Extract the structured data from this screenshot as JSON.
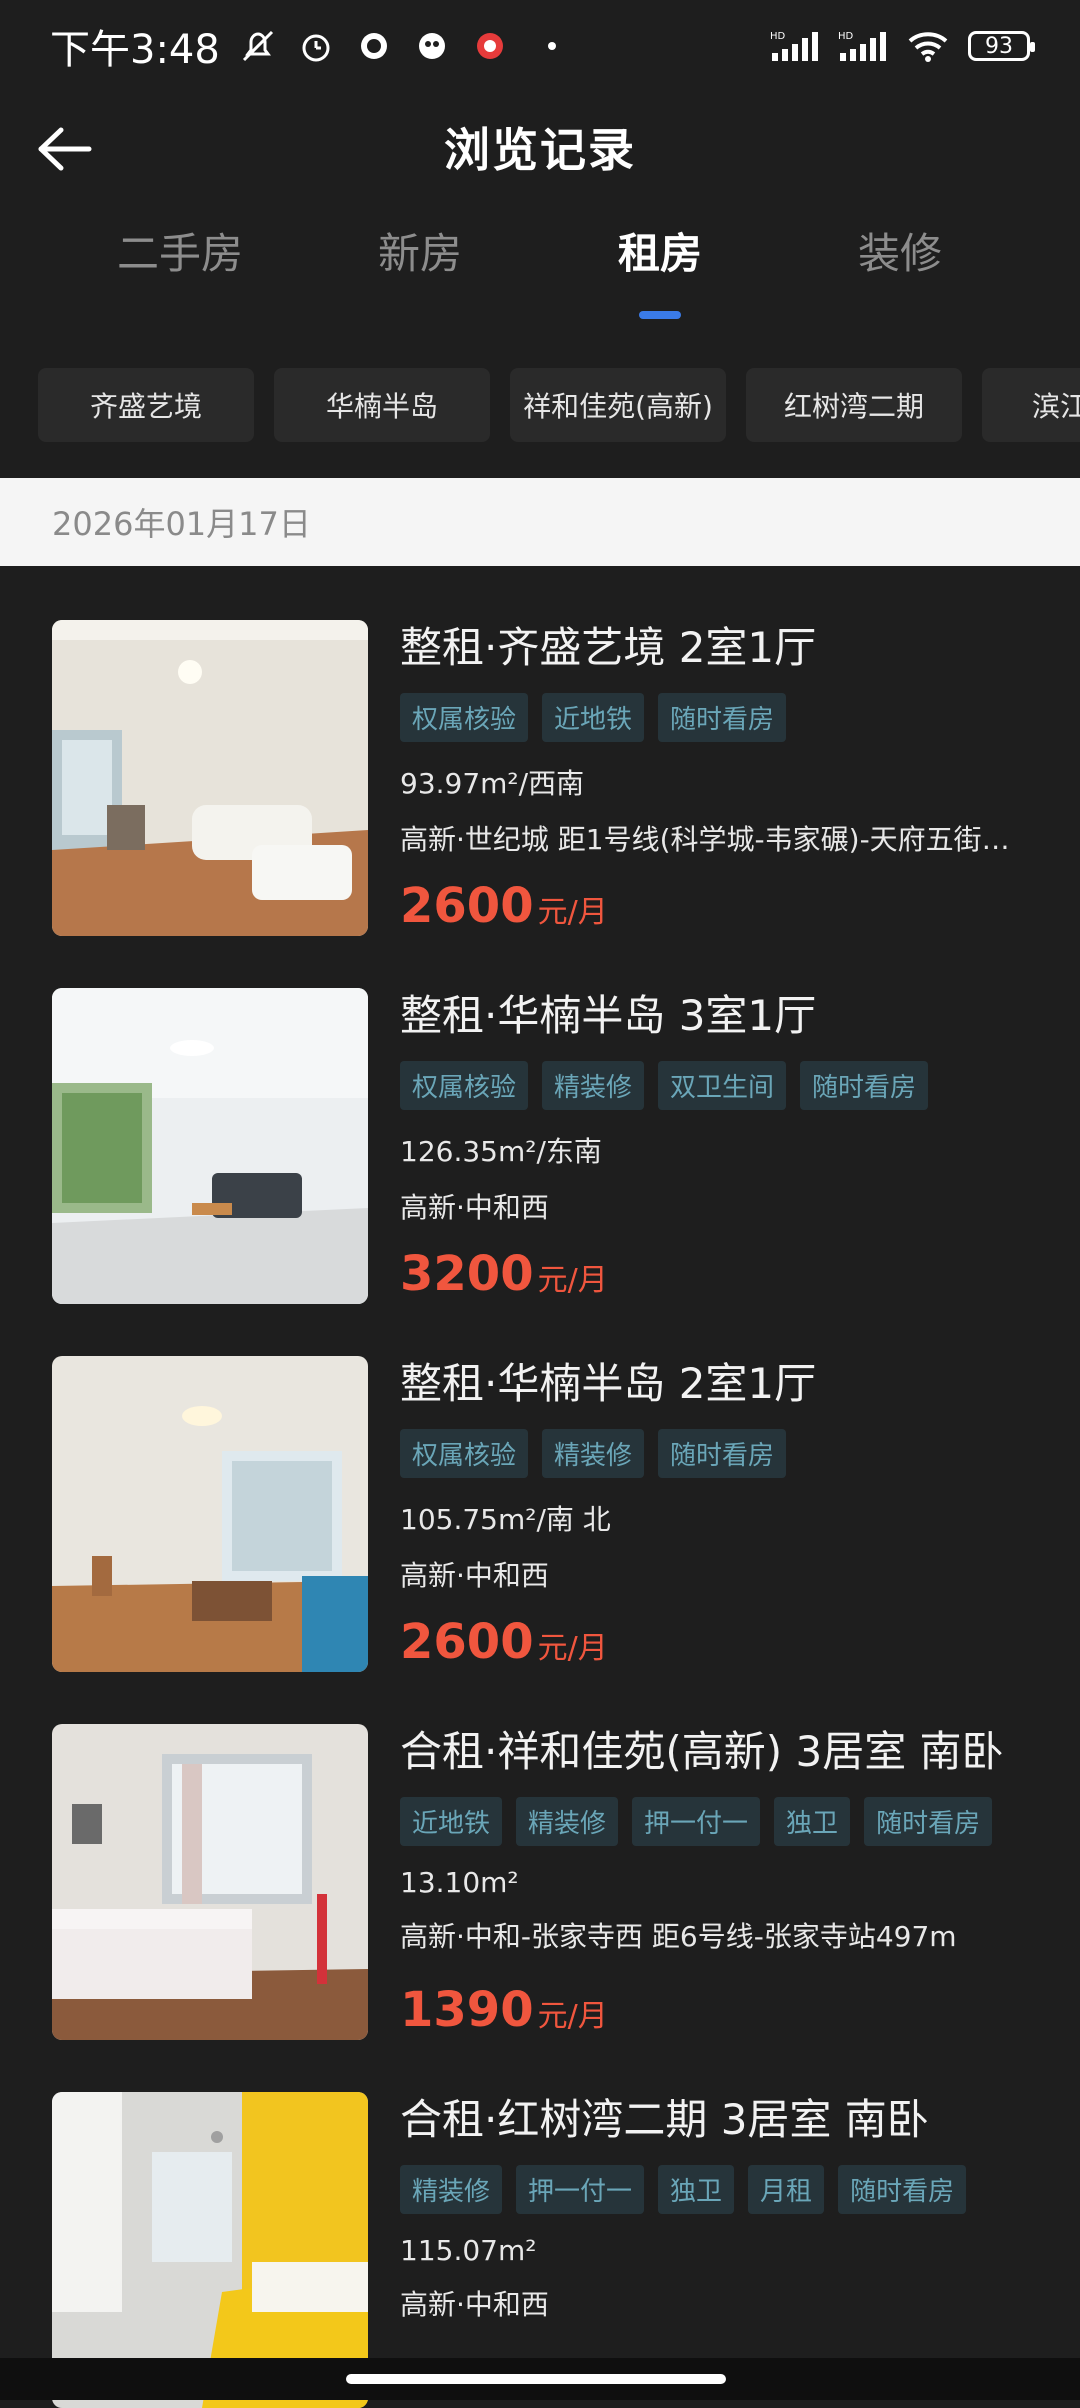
{
  "status_bar": {
    "time": "下午3:48",
    "battery": "93"
  },
  "header": {
    "title": "浏览记录",
    "back_icon": "arrow-left-icon"
  },
  "tabs": [
    {
      "label": "二手房",
      "active": false
    },
    {
      "label": "新房",
      "active": false
    },
    {
      "label": "租房",
      "active": true
    },
    {
      "label": "装修",
      "active": false
    }
  ],
  "chips": [
    "齐盛艺境",
    "华楠半岛",
    "祥和佳苑(高新)",
    "红树湾二期",
    "滨江"
  ],
  "date": "2026年01月17日",
  "listings": [
    {
      "title": "整租·齐盛艺境 2室1厅",
      "tags": [
        "权属核验",
        "近地铁",
        "随时看房"
      ],
      "area": "93.97m²/西南",
      "location": "高新·世纪城 距1号线(科学城-韦家碾)-天府五街…",
      "price": "2600",
      "unit": "元/月"
    },
    {
      "title": "整租·华楠半岛 3室1厅",
      "tags": [
        "权属核验",
        "精装修",
        "双卫生间",
        "随时看房"
      ],
      "area": "126.35m²/东南",
      "location": "高新·中和西",
      "price": "3200",
      "unit": "元/月"
    },
    {
      "title": "整租·华楠半岛 2室1厅",
      "tags": [
        "权属核验",
        "精装修",
        "随时看房"
      ],
      "area": "105.75m²/南 北",
      "location": "高新·中和西",
      "price": "2600",
      "unit": "元/月"
    },
    {
      "title": "合租·祥和佳苑(高新) 3居室 南卧",
      "tags": [
        "近地铁",
        "精装修",
        "押一付一",
        "独卫",
        "随时看房"
      ],
      "area": "13.10m²",
      "location": "高新·中和-张家寺西 距6号线-张家寺站497m",
      "price": "1390",
      "unit": "元/月"
    },
    {
      "title": "合租·红树湾二期 3居室 南卧",
      "tags": [
        "精装修",
        "押一付一",
        "独卫",
        "月租",
        "随时看房"
      ],
      "area": "115.07m²",
      "location": "高新·中和西",
      "price": "",
      "unit": ""
    }
  ],
  "colors": {
    "background": "#1e1e1e",
    "accent": "#3a7be8",
    "price": "#f0563e",
    "tag_bg": "#26343a",
    "tag_text": "#6aa6b8"
  }
}
